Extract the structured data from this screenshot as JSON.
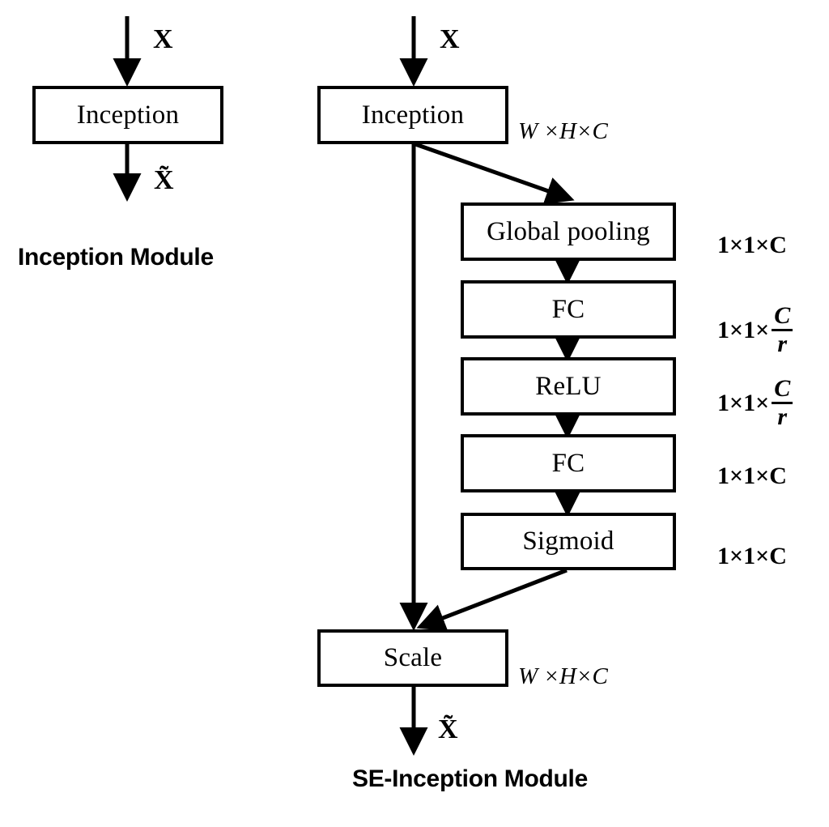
{
  "figure": {
    "title": "SE-Inception Module diagram",
    "background_color": "#ffffff",
    "stroke_color": "#000000"
  },
  "left_module": {
    "caption": "Inception Module",
    "input_label": "X",
    "output_label": "X̃",
    "blocks": [
      {
        "label": "Inception",
        "name": "inception-block"
      }
    ]
  },
  "right_module": {
    "caption": "SE-Inception Module",
    "input_label": "X",
    "output_label": "X̃",
    "blocks": [
      {
        "label": "Inception",
        "name": "inception-block"
      },
      {
        "label": "Global pooling",
        "name": "global-pooling-block"
      },
      {
        "label": "FC",
        "name": "fc-block-1"
      },
      {
        "label": "ReLU",
        "name": "relu-block"
      },
      {
        "label": "FC",
        "name": "fc-block-2"
      },
      {
        "label": "Sigmoid",
        "name": "sigmoid-block"
      },
      {
        "label": "Scale",
        "name": "scale-block"
      }
    ],
    "dimension_labels": [
      {
        "text": "W ×H×C",
        "for": "inception-block",
        "kind": "italic"
      },
      {
        "text": "1×1×C",
        "for": "global-pooling-block",
        "kind": "fraction-none"
      },
      {
        "text": "1×1×",
        "numerator": "C",
        "denominator": "r",
        "for": "fc-block-1",
        "kind": "fraction"
      },
      {
        "text": "1×1×",
        "numerator": "C",
        "denominator": "r",
        "for": "relu-block",
        "kind": "fraction"
      },
      {
        "text": "1×1×C",
        "for": "fc-block-2",
        "kind": "fraction-none"
      },
      {
        "text": "1×1×C",
        "for": "sigmoid-block",
        "kind": "fraction-none"
      },
      {
        "text": "W ×H×C",
        "for": "scale-block",
        "kind": "italic"
      }
    ],
    "dim_prefix": "1×1×"
  }
}
